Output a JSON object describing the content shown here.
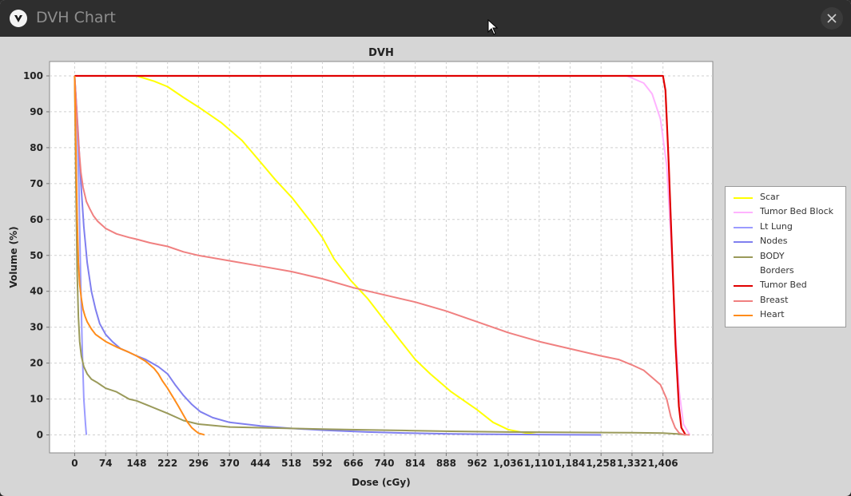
{
  "window": {
    "title": "DVH Chart"
  },
  "chart_data": {
    "type": "line",
    "title": "DVH",
    "xlabel": "Dose (cGy)",
    "ylabel": "Volume (%)",
    "xlim": [
      -60,
      1525
    ],
    "ylim": [
      -5,
      104
    ],
    "xticks": [
      0,
      74,
      148,
      222,
      296,
      370,
      444,
      518,
      592,
      666,
      740,
      814,
      888,
      962,
      1036,
      1110,
      1184,
      1258,
      1332,
      1406
    ],
    "xtick_labels": [
      "0",
      "74",
      "148",
      "222",
      "296",
      "370",
      "444",
      "518",
      "592",
      "666",
      "740",
      "814",
      "888",
      "962",
      "1,036",
      "1,110",
      "1,184",
      "1,258",
      "1,332",
      "1,406"
    ],
    "yticks": [
      0,
      10,
      20,
      30,
      40,
      50,
      60,
      70,
      80,
      90,
      100
    ],
    "grid": true,
    "legend_position": "right",
    "series": [
      {
        "name": "Scar",
        "color": "#ffff00",
        "x": [
          0,
          60,
          100,
          148,
          190,
          222,
          260,
          300,
          350,
          400,
          444,
          480,
          520,
          560,
          592,
          620,
          660,
          700,
          740,
          780,
          814,
          850,
          900,
          962,
          1000,
          1036,
          1080,
          1110
        ],
        "y": [
          100,
          100,
          100,
          100,
          98.5,
          97,
          94,
          91,
          87,
          82,
          76,
          71,
          66,
          60,
          55,
          49,
          43,
          38,
          32,
          26,
          21,
          17,
          12,
          7,
          3.5,
          1.5,
          0.5,
          0
        ]
      },
      {
        "name": "Tumor Bed Block",
        "color": "#ffb3ff",
        "x": [
          0,
          300,
          600,
          900,
          1200,
          1320,
          1340,
          1360,
          1380,
          1400,
          1415,
          1425,
          1435,
          1445,
          1455,
          1470
        ],
        "y": [
          100,
          100,
          100,
          100,
          100,
          100,
          99,
          98,
          95,
          88,
          75,
          55,
          30,
          12,
          3,
          0
        ]
      },
      {
        "name": "Lt Lung",
        "color": "#9b9bff",
        "x": [
          0,
          5,
          10,
          14,
          18,
          22,
          26,
          28
        ],
        "y": [
          100,
          90,
          70,
          45,
          25,
          10,
          3,
          0
        ]
      },
      {
        "name": "Nodes",
        "color": "#7f7fef",
        "x": [
          0,
          8,
          15,
          22,
          30,
          40,
          50,
          60,
          74,
          90,
          110,
          130,
          148,
          170,
          200,
          222,
          240,
          260,
          280,
          300,
          330,
          370,
          444,
          518,
          600,
          700,
          800,
          900,
          962,
          1100,
          1258
        ],
        "y": [
          100,
          85,
          70,
          58,
          48,
          40,
          35,
          31,
          28,
          26,
          24,
          23,
          22,
          21,
          19,
          17,
          14,
          11,
          8.5,
          6.5,
          4.8,
          3.5,
          2.5,
          1.8,
          1.3,
          0.8,
          0.5,
          0.3,
          0.2,
          0.1,
          0
        ]
      },
      {
        "name": "BODY",
        "color": "#9a9a5a",
        "x": [
          0,
          3,
          6,
          9,
          12,
          16,
          22,
          30,
          40,
          55,
          74,
          100,
          130,
          148,
          180,
          222,
          260,
          296,
          370,
          444,
          518,
          592,
          700,
          800,
          900,
          1036,
          1200,
          1332,
          1406,
          1440,
          1460
        ],
        "y": [
          100,
          70,
          45,
          33,
          26,
          22,
          19,
          17,
          15.5,
          14.5,
          13,
          12,
          10,
          9.5,
          8,
          6,
          4,
          3,
          2.2,
          2,
          1.8,
          1.6,
          1.4,
          1.2,
          1,
          0.8,
          0.7,
          0.6,
          0.5,
          0.3,
          0
        ]
      },
      {
        "name": "Borders",
        "color": "#ffffff",
        "x": [],
        "y": []
      },
      {
        "name": "Tumor Bed",
        "color": "#e00000",
        "x": [
          0,
          300,
          600,
          900,
          1200,
          1400,
          1406,
          1412,
          1420,
          1428,
          1436,
          1444,
          1450,
          1460
        ],
        "y": [
          100,
          100,
          100,
          100,
          100,
          100,
          100,
          96,
          75,
          50,
          25,
          8,
          2,
          0
        ]
      },
      {
        "name": "Breast",
        "color": "#f08080",
        "x": [
          0,
          5,
          10,
          15,
          20,
          28,
          36,
          45,
          55,
          74,
          100,
          130,
          148,
          180,
          222,
          260,
          296,
          370,
          444,
          518,
          592,
          666,
          740,
          814,
          888,
          962,
          1036,
          1110,
          1184,
          1258,
          1300,
          1332,
          1360,
          1380,
          1400,
          1415,
          1425,
          1435,
          1445,
          1455,
          1470
        ],
        "y": [
          100,
          90,
          80,
          73,
          69,
          65,
          63,
          61,
          59.5,
          57.5,
          56,
          55,
          54.5,
          53.5,
          52.5,
          51,
          50,
          48.5,
          47,
          45.5,
          43.5,
          41,
          39,
          37,
          34.5,
          31.5,
          28.5,
          26,
          24,
          22,
          21,
          19.5,
          18,
          16,
          14,
          10,
          5,
          2,
          0.5,
          0.1,
          0
        ]
      },
      {
        "name": "Heart",
        "color": "#ff8c1a",
        "x": [
          0,
          3,
          6,
          9,
          12,
          16,
          20,
          25,
          30,
          40,
          50,
          74,
          100,
          130,
          148,
          170,
          190,
          200,
          210,
          222,
          235,
          248,
          260,
          270,
          280,
          290,
          296,
          305,
          310
        ],
        "y": [
          100,
          80,
          60,
          48,
          42,
          38,
          35,
          33,
          31.5,
          29.5,
          28,
          26,
          24.5,
          23,
          22,
          20.5,
          18.5,
          17,
          15,
          13,
          10.5,
          8,
          5.5,
          3.5,
          2,
          1,
          0.5,
          0.2,
          0
        ]
      }
    ]
  }
}
